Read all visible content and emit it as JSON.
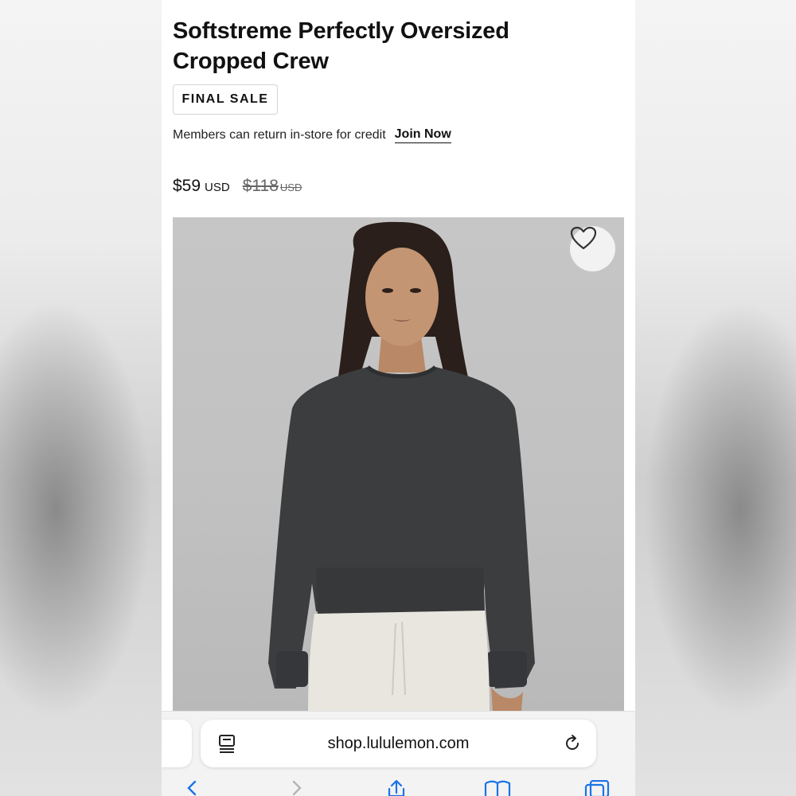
{
  "product": {
    "title_line1": "Softstreme Perfectly Oversized",
    "title_line2": "Cropped Crew",
    "badge": "FINAL SALE",
    "members_text": "Members can return in-store for credit",
    "join_link": "Join Now",
    "price": "$59",
    "price_currency": "USD",
    "original_price": "$118",
    "original_currency": "USD"
  },
  "image": {
    "favorite_icon": "heart-icon"
  },
  "browser": {
    "url": "shop.lululemon.com",
    "reader_icon": "reader-mode-icon",
    "reload_icon": "reload-icon",
    "toolbar": [
      "back-icon",
      "forward-icon",
      "share-icon",
      "bookmarks-icon",
      "tabs-icon"
    ],
    "accent": "#1a73e8"
  }
}
